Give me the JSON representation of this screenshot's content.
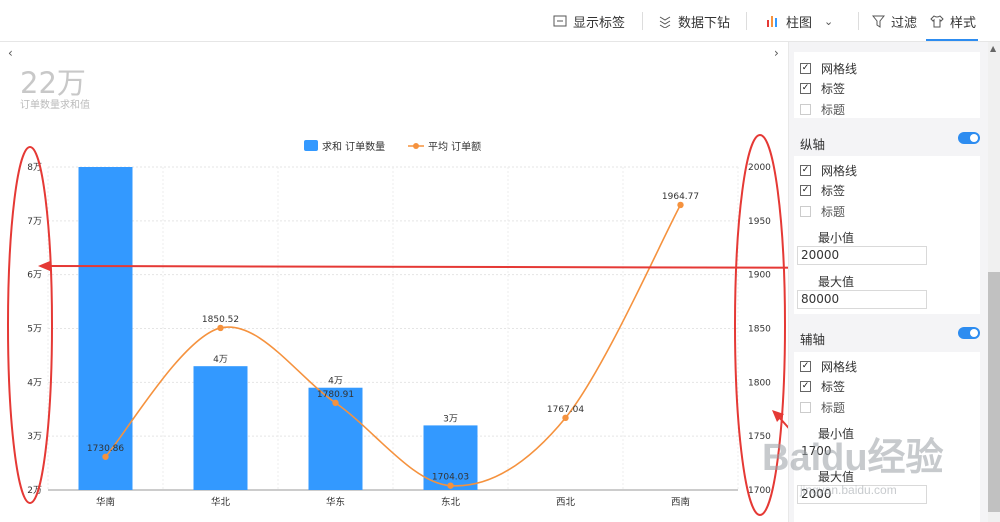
{
  "toolbar": {
    "show_labels": "显示标签",
    "drill_down": "数据下钻",
    "chart_type": "柱图",
    "filter": "过滤",
    "style": "样式"
  },
  "kpi": {
    "value": "22万",
    "label": "订单数量求和值"
  },
  "chart_data": {
    "type": "bar",
    "categories": [
      "华南",
      "华北",
      "华东",
      "东北",
      "西北",
      "西南"
    ],
    "series": [
      {
        "name": "求和 订单数量",
        "kind": "bar",
        "axis": "left",
        "values": [
          85000,
          43000,
          39000,
          32000,
          null,
          null
        ],
        "labels": [
          "",
          "4万",
          "4万",
          "3万",
          "",
          ""
        ]
      },
      {
        "name": "平均 订单额",
        "kind": "line",
        "axis": "right",
        "values": [
          1730.86,
          1850.52,
          1780.91,
          1704.03,
          1767.04,
          1964.77
        ],
        "labels": [
          "1730.86",
          "1850.52",
          "1780.91",
          "1704.03",
          "1767.04",
          "1964.77"
        ]
      }
    ],
    "y_left": {
      "ylim": [
        20000,
        80000
      ],
      "ticks": [
        "2万",
        "3万",
        "4万",
        "5万",
        "6万",
        "7万",
        "8万"
      ]
    },
    "y_right": {
      "ylim": [
        1700,
        2000
      ],
      "ticks": [
        "1700",
        "1750",
        "1800",
        "1850",
        "1900",
        "1950",
        "2000"
      ]
    },
    "grid": true,
    "legend": "top-center",
    "colors": {
      "bar": "#3399ff",
      "line": "#f5923e"
    }
  },
  "panel": {
    "x_axis_options": [
      {
        "label": "网格线",
        "checked": true
      },
      {
        "label": "标签",
        "checked": true
      },
      {
        "label": "标题",
        "checked": false
      }
    ],
    "y_axis": {
      "title": "纵轴",
      "options": [
        {
          "label": "网格线",
          "checked": true
        },
        {
          "label": "标签",
          "checked": true
        },
        {
          "label": "标题",
          "checked": false
        }
      ],
      "min_label": "最小值",
      "min_value": "20000",
      "max_label": "最大值",
      "max_value": "80000"
    },
    "secondary_axis": {
      "title": "辅轴",
      "options": [
        {
          "label": "网格线",
          "checked": true
        },
        {
          "label": "标签",
          "checked": true
        },
        {
          "label": "标题",
          "checked": false
        }
      ],
      "min_label": "最小值",
      "min_value": "1700",
      "max_label": "最大值",
      "max_value": "2000"
    }
  },
  "watermark": {
    "brand": "Baidu经验",
    "url": "jingyan.baidu.com"
  },
  "colors": {
    "accent": "#2d8cf0",
    "annotation": "#e53935"
  }
}
